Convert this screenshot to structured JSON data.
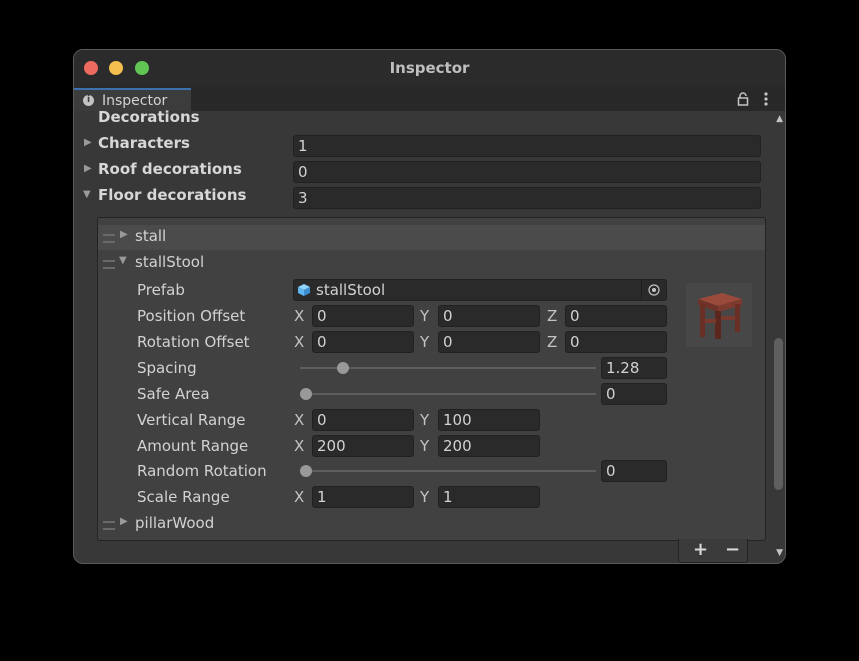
{
  "window": {
    "title": "Inspector"
  },
  "tab": {
    "label": "Inspector"
  },
  "header": {
    "decorations": "Decorations"
  },
  "fields": {
    "characters": {
      "label": "Characters",
      "value": "1"
    },
    "roof": {
      "label": "Roof decorations",
      "value": "0"
    },
    "floor": {
      "label": "Floor decorations",
      "value": "3"
    }
  },
  "list": {
    "items": [
      "stall",
      "stallStool",
      "pillarWood"
    ]
  },
  "props": {
    "prefab": {
      "label": "Prefab",
      "value": "stallStool"
    },
    "position_offset": {
      "label": "Position Offset",
      "x": "0",
      "y": "0",
      "z": "0"
    },
    "rotation_offset": {
      "label": "Rotation Offset",
      "x": "0",
      "y": "0",
      "z": "0"
    },
    "spacing": {
      "label": "Spacing",
      "value": "1.28",
      "slider_fraction": 0.13
    },
    "safe_area": {
      "label": "Safe Area",
      "value": "0",
      "slider_fraction": 0
    },
    "vertical_range": {
      "label": "Vertical Range",
      "x": "0",
      "y": "100"
    },
    "amount_range": {
      "label": "Amount Range",
      "x": "200",
      "y": "200"
    },
    "random_rotation": {
      "label": "Random Rotation",
      "value": "0",
      "slider_fraction": 0
    },
    "scale_range": {
      "label": "Scale Range",
      "x": "1",
      "y": "1"
    }
  },
  "axes": {
    "x": "X",
    "y": "Y",
    "z": "Z"
  },
  "footer": {
    "add": "+",
    "remove": "−"
  },
  "icons": {
    "info": "info-icon",
    "lock": "lock-icon",
    "menu": "kebab-menu-icon",
    "prefab": "prefab-cube-icon",
    "picker": "object-picker-icon"
  },
  "colors": {
    "accent": "#3a72b0",
    "prefab_icon": "#5fb6f0"
  }
}
